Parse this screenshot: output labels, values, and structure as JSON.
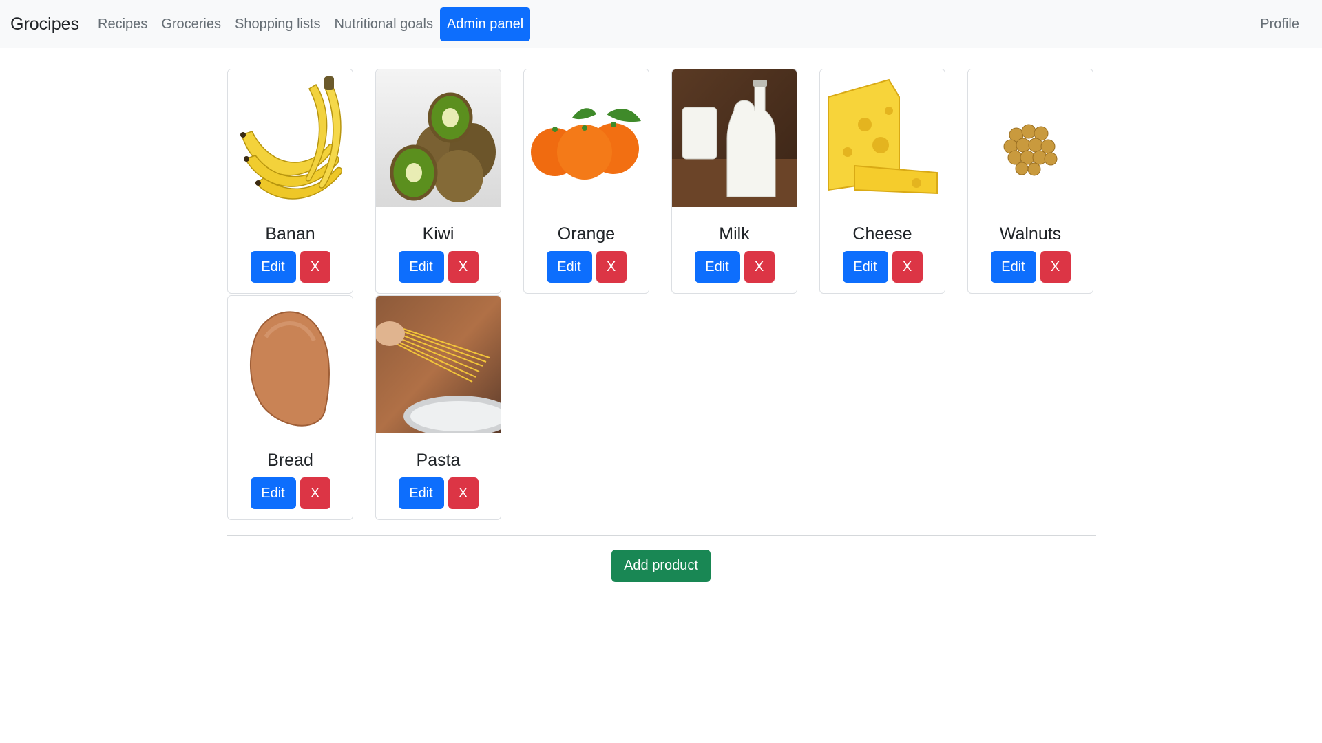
{
  "nav": {
    "brand": "Grocipes",
    "links": [
      "Recipes",
      "Groceries",
      "Shopping lists",
      "Nutritional goals",
      "Admin panel"
    ],
    "active": "Admin panel",
    "profile": "Profile"
  },
  "products": [
    {
      "name": "Banan",
      "edit_label": "Edit",
      "delete_label": "X"
    },
    {
      "name": "Kiwi",
      "edit_label": "Edit",
      "delete_label": "X"
    },
    {
      "name": "Orange",
      "edit_label": "Edit",
      "delete_label": "X"
    },
    {
      "name": "Milk",
      "edit_label": "Edit",
      "delete_label": "X"
    },
    {
      "name": "Cheese",
      "edit_label": "Edit",
      "delete_label": "X"
    },
    {
      "name": "Walnuts",
      "edit_label": "Edit",
      "delete_label": "X"
    },
    {
      "name": "Bread",
      "edit_label": "Edit",
      "delete_label": "X"
    },
    {
      "name": "Pasta",
      "edit_label": "Edit",
      "delete_label": "X"
    }
  ],
  "footer": {
    "add_label": "Add product"
  },
  "colors": {
    "primary": "#0d6efd",
    "danger": "#dc3545",
    "success": "#198754",
    "navbar_bg": "#f8f9fa"
  }
}
